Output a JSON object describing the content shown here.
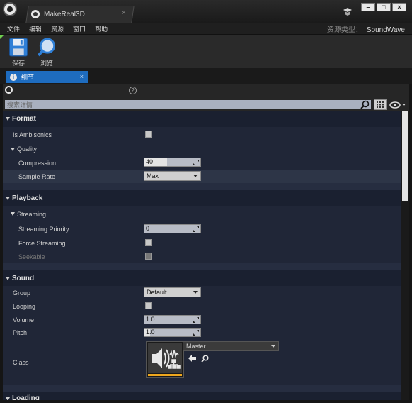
{
  "window": {
    "tab_title": "MakeReal3D",
    "tab_close": "×",
    "minimize": "–",
    "maximize": "□",
    "close": "×"
  },
  "menu": {
    "items": [
      "文件",
      "编辑",
      "资源",
      "窗口",
      "帮助"
    ],
    "asset_type_label": "资源类型：",
    "asset_type_value": "SoundWave"
  },
  "toolbar": {
    "save_label": "保存",
    "browse_label": "浏览"
  },
  "panel": {
    "tab_label": "细节",
    "tab_close": "×",
    "info_glyph": "i",
    "help_glyph": "?",
    "search_placeholder": "搜索详情"
  },
  "sections": {
    "format": {
      "title": "Format",
      "is_ambisonics": {
        "label": "Is Ambisonics",
        "checked": false
      },
      "quality": {
        "title": "Quality"
      },
      "compression": {
        "label": "Compression",
        "value": "40",
        "fill": 0.4
      },
      "sample_rate": {
        "label": "Sample Rate",
        "value": "Max"
      }
    },
    "playback": {
      "title": "Playback",
      "streaming": {
        "title": "Streaming"
      },
      "streaming_priority": {
        "label": "Streaming Priority",
        "value": "0"
      },
      "force_streaming": {
        "label": "Force Streaming",
        "checked": false
      },
      "seekable": {
        "label": "Seekable",
        "checked": false,
        "disabled": true
      }
    },
    "sound": {
      "title": "Sound",
      "group": {
        "label": "Group",
        "value": "Default"
      },
      "looping": {
        "label": "Looping",
        "checked": false
      },
      "volume": {
        "label": "Volume",
        "value": "1.0"
      },
      "pitch": {
        "label": "Pitch",
        "value": "1.0",
        "fill": 0.1
      },
      "class": {
        "label": "Class",
        "value": "Master"
      }
    },
    "loading": {
      "title": "Loading"
    }
  },
  "colors": {
    "accent_tab": "#1e6cbf",
    "category_bg": "#1a2030",
    "property_bg": "#202637",
    "class_underline": "#f0a81e"
  },
  "icons": {
    "logo": "unreal-logo-icon",
    "doc_tab": "asset-icon",
    "save": "save-disk-icon",
    "browse": "magnifier-icon",
    "search": "search-icon",
    "grid": "grid-view-icon",
    "eye": "eye-icon",
    "class_thumb": "sound-class-icon",
    "use_selected": "arrow-left-icon",
    "browse_asset": "search-icon"
  }
}
